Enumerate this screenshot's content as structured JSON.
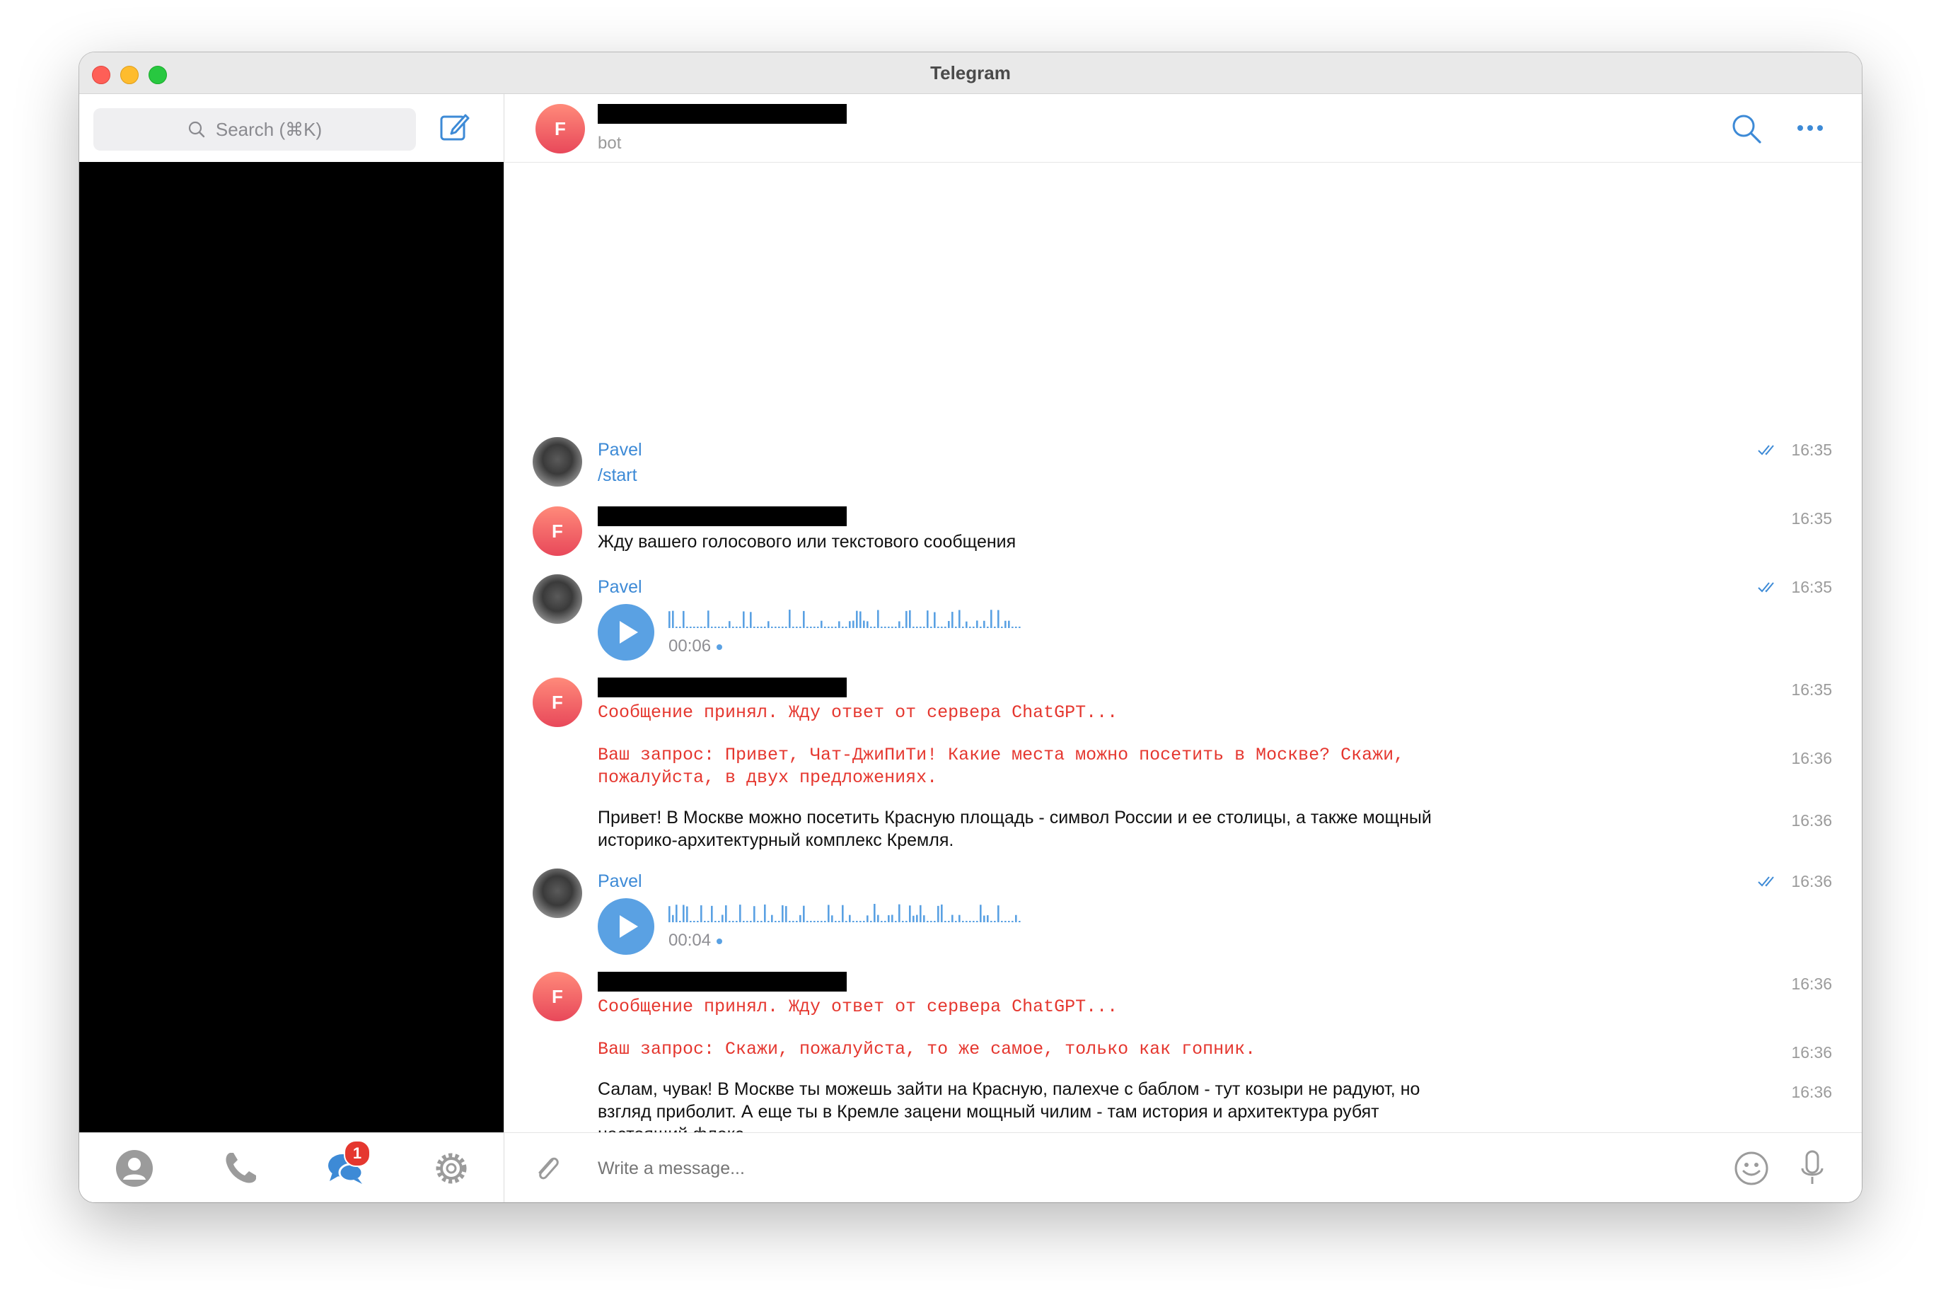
{
  "window": {
    "title": "Telegram"
  },
  "sidebar": {
    "search_placeholder": "Search (⌘K)",
    "tabs": [
      {
        "name": "contacts",
        "icon": "person-icon"
      },
      {
        "name": "calls",
        "icon": "phone-icon"
      },
      {
        "name": "chats",
        "icon": "chat-bubbles-icon",
        "badge": "1"
      },
      {
        "name": "settings",
        "icon": "gear-icon"
      }
    ]
  },
  "chat": {
    "avatar_letter": "F",
    "status": "bot"
  },
  "messages": [
    {
      "sender": "Pavel",
      "text": "/start",
      "time": "16:35",
      "read": true
    },
    {
      "sender_avatar": "F",
      "text": "Жду вашего голосового или текстового сообщения",
      "time": "16:35"
    },
    {
      "sender": "Pavel",
      "voice_duration": "00:06",
      "time": "16:35",
      "read": true
    },
    {
      "sender_avatar": "F",
      "text": "Сообщение принял. Жду ответ от сервера ChatGPT...",
      "time": "16:35"
    },
    {
      "text_line1": "Ваш запрос: Привет, Чат-ДжиПиТи! Какие места можно посетить в Москве? Скажи,",
      "text_line2": "пожалуйста, в двух предложениях.",
      "time": "16:36"
    },
    {
      "text_line1": "Привет! В Москве можно посетить Красную площадь - символ России и ее столицы, а также мощный",
      "text_line2": "историко-архитектурный комплекс Кремля.",
      "time": "16:36"
    },
    {
      "sender": "Pavel",
      "voice_duration": "00:04",
      "time": "16:36",
      "read": true
    },
    {
      "sender_avatar": "F",
      "text": "Сообщение принял. Жду ответ от сервера ChatGPT...",
      "time": "16:36"
    },
    {
      "text": "Ваш запрос: Скажи, пожалуйста, то же самое, только как гопник.",
      "time": "16:36"
    },
    {
      "text_line1": "Салам, чувак! В Москве ты можешь зайти на Красную, палехче с баблом - тут козыри не радуют, но",
      "text_line2": "взгляд приболит. А еще ты в Кремле зацени мощный чилим - там история и архитектура рубят",
      "text_line3": "настоящий флекс.",
      "time": "16:36"
    }
  ],
  "composer": {
    "placeholder": "Write a message..."
  },
  "colors": {
    "accent": "#3d8ad6",
    "bot_mono": "#e5372f",
    "badge": "#e5372f"
  }
}
